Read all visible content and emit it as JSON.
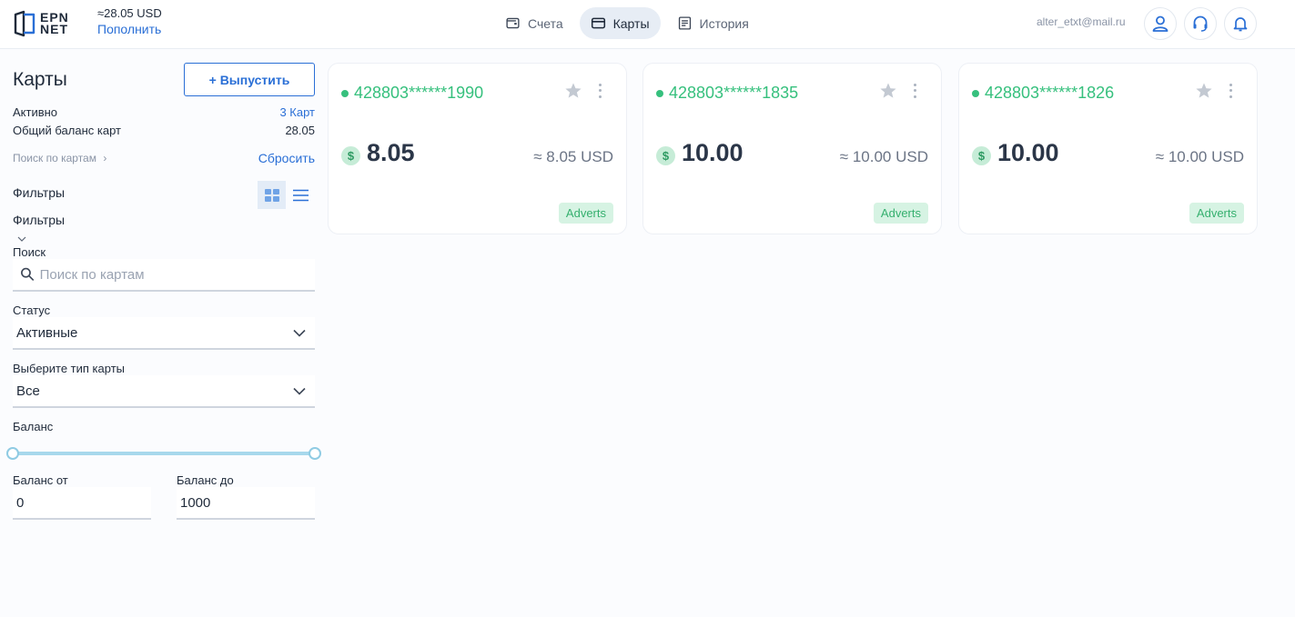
{
  "header": {
    "logo_text_line1": "EPN",
    "logo_text_line2": "NET",
    "total_balance": "≈28.05 USD",
    "topup_label": "Пополнить",
    "nav": [
      {
        "label": "Счета",
        "icon": "wallet-icon",
        "active": false
      },
      {
        "label": "Карты",
        "icon": "card-icon",
        "active": true
      },
      {
        "label": "История",
        "icon": "history-icon",
        "active": false
      }
    ],
    "user_email": "alter_etxt@mail.ru"
  },
  "sidebar": {
    "title": "Карты",
    "issue_button": "+ Выпустить",
    "active_label": "Активно",
    "active_value": "3 Карт",
    "total_label": "Общий баланс карт",
    "total_value": "28.05",
    "search_cards_link": "Поиск по картам",
    "reset_link": "Сбросить",
    "filters_label": "Фильтры",
    "filters_label_2": "Фильтры",
    "search_label": "Поиск",
    "search_placeholder": "Поиск по картам",
    "status_label": "Статус",
    "status_value": "Активные",
    "card_type_label": "Выберите тип карты",
    "card_type_value": "Все",
    "balance_label": "Баланс",
    "balance_from_label": "Баланс от",
    "balance_from_value": "0",
    "balance_to_label": "Баланс до",
    "balance_to_value": "1000"
  },
  "cards": [
    {
      "number": "428803******1990",
      "amount": "8.05",
      "usd": "≈ 8.05 USD",
      "tag": "Adverts"
    },
    {
      "number": "428803******1835",
      "amount": "10.00",
      "usd": "≈ 10.00 USD",
      "tag": "Adverts"
    },
    {
      "number": "428803******1826",
      "amount": "10.00",
      "usd": "≈ 10.00 USD",
      "tag": "Adverts"
    }
  ],
  "colors": {
    "accent": "#2a6fd6",
    "positive": "#36c07d",
    "slider": "#a7d8ec"
  }
}
